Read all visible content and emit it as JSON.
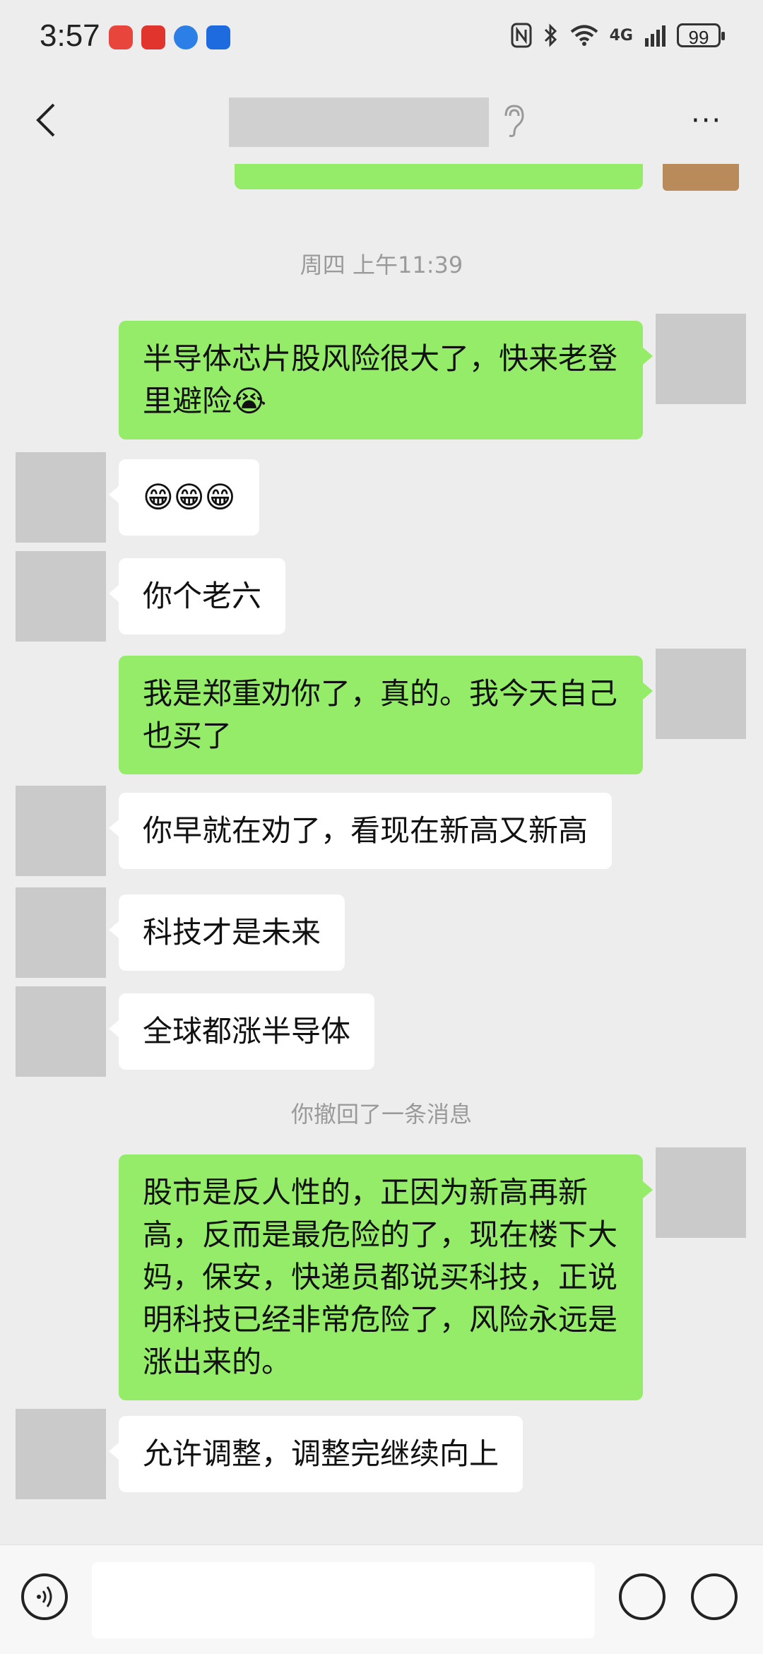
{
  "status_bar": {
    "time": "3:57",
    "network": "4G",
    "battery": "99"
  },
  "header": {
    "more_label": "···"
  },
  "messages": {
    "ts1": "周四 上午11:39",
    "m1": "半导体芯片股风险很大了，快来老登里避险😭",
    "m2": "😁😁😁",
    "m3": "你个老六",
    "m4": "我是郑重劝你了，真的。我今天自己也买了",
    "m5": "你早就在劝了，看现在新高又新高",
    "m6": "科技才是未来",
    "m7": "全球都涨半导体",
    "recall": "你撤回了一条消息",
    "m8": "股市是反人性的，正因为新高再新高，反而是最危险的了，现在楼下大妈，保安，快递员都说买科技，正说明科技已经非常危险了，风险永远是涨出来的。",
    "m9": "允许调整，调整完继续向上"
  },
  "colors": {
    "me_bubble": "#95ec69",
    "other_bubble": "#ffffff",
    "background": "#ededed"
  }
}
